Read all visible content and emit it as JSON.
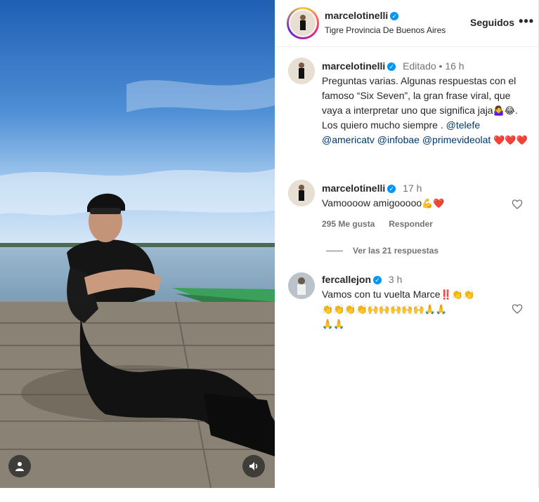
{
  "header": {
    "username": "marcelotinelli",
    "location": "Tigre Provincia De Buenos Aires",
    "follow_label": "Seguidos",
    "more_label": "•••"
  },
  "caption": {
    "username": "marcelotinelli",
    "edited": "Editado",
    "time": "16 h",
    "text": "Preguntas varias. Algunas respuestas con el famoso “Six Seven”, la gran  frase viral, que vaya a interpretar uno que significa jaja",
    "text_tail": ". Los quiero mucho siempre .",
    "mentions": [
      "@telefe",
      "@americatv",
      "@infobae",
      "@primevideolat"
    ],
    "emojis": "🤷‍♀️😂",
    "hearts": "❤️❤️❤️"
  },
  "comments": [
    {
      "username": "marcelotinelli",
      "time": "17 h",
      "text": "Vamoooow amigooooo",
      "emojis": "💪❤️",
      "likes": "295 Me gusta",
      "reply_label": "Responder",
      "view_replies": "Ver las 21 respuestas"
    },
    {
      "username": "fercallejon",
      "time": "3 h",
      "text": "Vamos con tu vuelta Marce",
      "emojis_line1": "‼️👏👏",
      "emojis_line2": "👏👏👏👏🙌🙌🙌🙌🙌🙏🙏",
      "emojis_line3": "🙏🙏"
    }
  ],
  "colors": {
    "verified": "#0095f6",
    "link": "#00376b",
    "muted": "#737373",
    "sky": "#2a6fc0",
    "heart": "#ed4956"
  }
}
